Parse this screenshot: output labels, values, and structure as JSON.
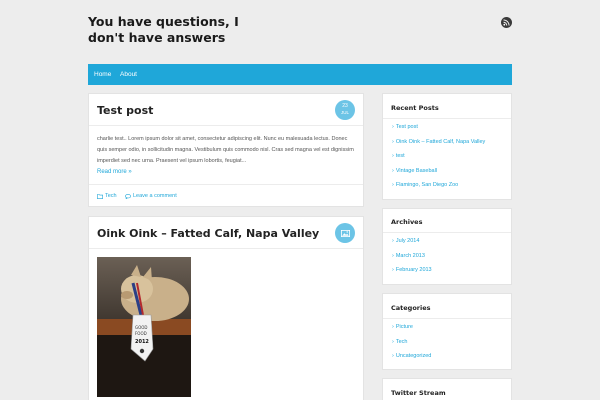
{
  "site": {
    "title": "You have questions, I don't have answers",
    "rss_icon": "rss-icon"
  },
  "nav": {
    "items": [
      {
        "label": "Home"
      },
      {
        "label": "About"
      }
    ]
  },
  "posts": [
    {
      "title": "Test post",
      "date_day": "23",
      "date_month": "JUL",
      "excerpt": "charlie test.. Lorem ipsum dolor sit amet, consectetur adipiscing elit. Nunc eu malesuada lectus. Donec quis semper odio, in sollicitudin magna. Vestibulum quis commodo nisl. Cras sed magna vel est dignissim imperdiet sed nec urna. Praesent vel ipsum lobortis, feugiat...",
      "read_more": "Read more »",
      "category": "Tech",
      "comments": "Leave a comment"
    },
    {
      "title": "Oink Oink – Fatted Calf, Napa Valley",
      "badge_icon": "image-icon"
    }
  ],
  "sidebar": {
    "recent_posts": {
      "title": "Recent Posts",
      "items": [
        "Test post",
        "Oink Oink – Fatted Calf, Napa Valley",
        "test",
        "Vintage Baseball",
        "Flamingo, San Diego Zoo"
      ]
    },
    "archives": {
      "title": "Archives",
      "items": [
        "July 2014",
        "March 2013",
        "February 2013"
      ]
    },
    "categories": {
      "title": "Categories",
      "items": [
        "Picture",
        "Tech",
        "Uncategorized"
      ]
    },
    "twitter": {
      "title": "Twitter Stream"
    }
  },
  "colors": {
    "accent": "#1fa7d9",
    "badge": "#6cc4e6",
    "background": "#ededed"
  }
}
